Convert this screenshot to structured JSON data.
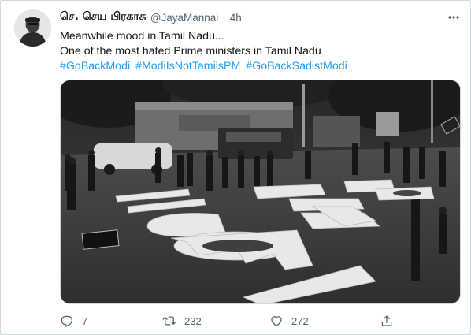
{
  "tweet": {
    "author_name": "செ. செய பிரகாசு",
    "handle": "@JayaMannai",
    "separator": "·",
    "time": "4h",
    "lines": [
      "Meanwhile mood in Tamil Nadu...",
      "One of the most hated Prime ministers in Tamil Nadu"
    ],
    "hashtags": [
      "#GoBackModi",
      "#ModiIsNotTamilsPM",
      "#GoBackSadistModi"
    ]
  },
  "media": {
    "description_icon": "street-protest-photo",
    "street_text": "GO BACK MODI",
    "colors": {
      "road": "#3a3a3a",
      "paint": "#e8e8e8",
      "sky": "#1c1c1c"
    }
  },
  "actions": {
    "reply_count": "7",
    "retweet_count": "232",
    "like_count": "272"
  },
  "icons": {
    "more": "more-icon",
    "reply": "reply-icon",
    "retweet": "retweet-icon",
    "like": "heart-icon",
    "share": "share-icon"
  },
  "colors": {
    "link": "#1d9bf0",
    "muted": "#536471",
    "text": "#0f1419",
    "border": "#cfd9de"
  }
}
